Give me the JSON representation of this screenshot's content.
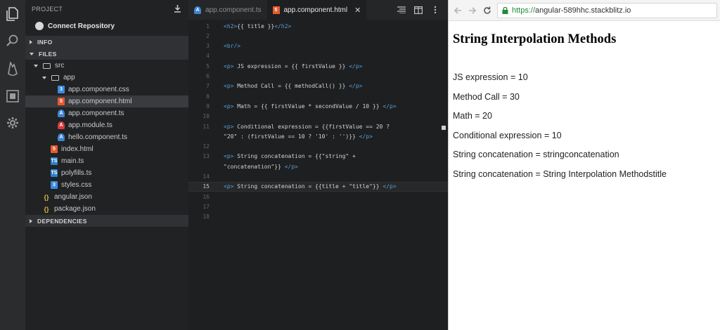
{
  "sidebar": {
    "project_label": "PROJECT",
    "connect_repository": "Connect Repository",
    "sections": {
      "info": "INFO",
      "files": "FILES",
      "dependencies": "DEPENDENCIES"
    },
    "tree": {
      "src": "src",
      "app": "app",
      "app_files": [
        {
          "name": "app.component.css",
          "icon": "css-file-icon"
        },
        {
          "name": "app.component.html",
          "icon": "html-file-icon",
          "selected": true
        },
        {
          "name": "app.component.ts",
          "icon": "angular-file-icon"
        },
        {
          "name": "app.module.ts",
          "icon": "angular-module-icon"
        },
        {
          "name": "hello.component.ts",
          "icon": "angular-file-icon"
        }
      ],
      "src_files": [
        {
          "name": "index.html",
          "icon": "html-file-icon"
        },
        {
          "name": "main.ts",
          "icon": "ts-file-icon"
        },
        {
          "name": "polyfills.ts",
          "icon": "ts-file-icon"
        },
        {
          "name": "styles.css",
          "icon": "css-file-icon"
        }
      ],
      "root_files": [
        {
          "name": "angular.json",
          "icon": "json-file-icon"
        },
        {
          "name": "package.json",
          "icon": "json-file-icon"
        }
      ]
    }
  },
  "editor": {
    "tabs": [
      {
        "label": "app.component.ts",
        "active": false,
        "icon": "angular-file-icon"
      },
      {
        "label": "app.component.html",
        "active": true,
        "icon": "html-file-icon"
      }
    ],
    "close_glyph": "✕",
    "current_line": 15,
    "lines": [
      {
        "n": "1",
        "text": "<h2>{{ title }}</h2>"
      },
      {
        "n": "2",
        "text": ""
      },
      {
        "n": "3",
        "text": "<br/>"
      },
      {
        "n": "4",
        "text": ""
      },
      {
        "n": "5",
        "text": "<p> JS expression = {{ firstValue }} </p>"
      },
      {
        "n": "6",
        "text": ""
      },
      {
        "n": "7",
        "text": "<p> Method Call = {{ methodCall() }} </p>"
      },
      {
        "n": "8",
        "text": ""
      },
      {
        "n": "9",
        "text": "<p> Math = {{ firstValue * secondValue / 10 }} </p>"
      },
      {
        "n": "10",
        "text": ""
      },
      {
        "n": "11",
        "text": "<p> Conditional expression = {{firstValue == 20 ?"
      },
      {
        "n": "",
        "text": "\"20\" : (firstValue == 10 ? '10' : '')}} </p>"
      },
      {
        "n": "12",
        "text": ""
      },
      {
        "n": "13",
        "text": "<p> String concatenation = {{\"string\" +"
      },
      {
        "n": "",
        "text": "\"concatenation\"}} </p>"
      },
      {
        "n": "14",
        "text": ""
      },
      {
        "n": "15",
        "text": "<p> String concatenation = {{title + \"title\"}} </p>"
      },
      {
        "n": "16",
        "text": ""
      },
      {
        "n": "17",
        "text": ""
      },
      {
        "n": "18",
        "text": ""
      }
    ]
  },
  "browser": {
    "url_secure": "https://",
    "url_rest": "angular-589hhc.stackblitz.io",
    "heading": "String Interpolation Methods",
    "paragraphs": [
      "JS expression = 10",
      "Method Call = 30",
      "Math = 20",
      "Conditional expression = 10",
      "String concatenation = stringconcatenation",
      "String concatenation = String Interpolation Methodstitle"
    ]
  },
  "colors": {
    "activity_bar": "#2a2c2e",
    "sidebar": "#202224",
    "editor": "#1e1f21",
    "tag_blue": "#569cd6",
    "secure_green": "#1f8a3b"
  }
}
